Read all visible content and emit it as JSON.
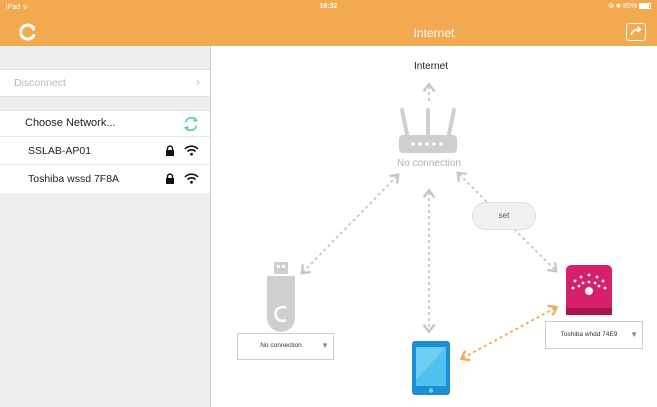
{
  "status_bar": {
    "left": "iPad ᯤ",
    "time": "16:32",
    "right": "85%"
  },
  "header": {
    "title": "Internet",
    "logo_icon": "refresh-c-icon",
    "share_icon": "share-icon"
  },
  "sidebar": {
    "disconnect_label": "Disconnect",
    "disconnect_chevron": "›",
    "choose_network_label": "Choose Network...",
    "networks": [
      {
        "name": "SSLAB-AP01",
        "secured": true,
        "icon": "wifi-icon"
      },
      {
        "name": "Toshiba wssd 7F8A",
        "secured": true,
        "icon": "wifi-icon"
      }
    ]
  },
  "diagram": {
    "internet_label": "Internet",
    "router_status": "No connection",
    "set_label": "set",
    "usb_device": {
      "selected": "No connection",
      "arrow": "▼"
    },
    "disk_device": {
      "selected": "Toshiba whdd 74E9",
      "arrow": "▼"
    }
  },
  "colors": {
    "accent": "#f2a950",
    "device_pink": "#d81f6b",
    "tablet_blue": "#1a8fd6",
    "link_gray": "#c6c6c6",
    "link_orange": "#f2a950"
  }
}
